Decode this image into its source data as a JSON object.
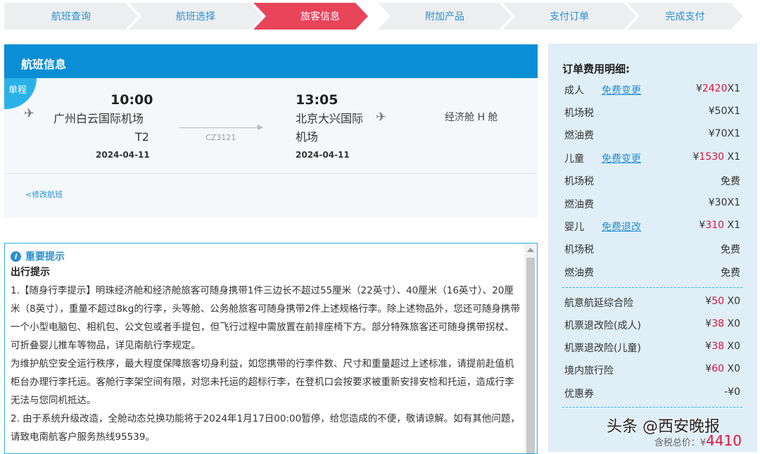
{
  "steps": [
    "航班查询",
    "航班选择",
    "旅客信息",
    "附加产品",
    "支付订单",
    "完成支付"
  ],
  "active_step": 2,
  "flight": {
    "header": "航班信息",
    "tag": "单程",
    "dep_time": "10:00",
    "dep_airport_line1": "广州白云国际机场",
    "dep_airport_line2": "T2",
    "dep_date": "2024-04-11",
    "flight_no": "CZ3121",
    "arr_time": "13:05",
    "arr_airport_line1": "北京大兴国际",
    "arr_airport_line2": "机场",
    "arr_date": "2024-04-11",
    "cabin": "经济舱 H 舱",
    "modify_link": "<修改航班"
  },
  "tips": {
    "title": "重要提示",
    "subtitle": "出行提示",
    "p1": "1.【随身行李提示】明珠经济舱和经济舱旅客可随身携带1件三边长不超过55厘米（22英寸）、40厘米（16英寸）、20厘米（8英寸），重量不超过8kg的行李，头等舱、公务舱旅客可随身携带2件上述规格行李。除上述物品外，您还可随身携带一个小型电脑包、相机包、公文包或者手提包，但飞行过程中需放置在前排座椅下方。部分特殊旅客还可随身携带拐杖、可折叠婴儿推车等物品，详见南航行李规定。",
    "p2": "为维护航空安全运行秩序，最大程度保障旅客切身利益，如您携带的行李件数、尺寸和重量超过上述标准，请提前赴值机柜台办理行李托运。客舱行李架空间有限，对您未托运的超标行李，在登机口会按要求被重新安排安检和托运，造成行李无法与您同机抵达。",
    "p3": "2. 由于系统升级改造，全舱动态兑换功能将于2024年1月17日00:00暂停，给您造成的不便，敬请谅解。如有其他问题，请致电南航客户服务热线95539。"
  },
  "order": {
    "title": "订单费用明细:",
    "rows": [
      {
        "label": "成人",
        "link": "免费变更",
        "cur": "¥",
        "amount": "2420",
        "qty": "X1",
        "amount_red": true
      },
      {
        "label": "机场税",
        "link": "",
        "cur": "",
        "amount": "¥50X1",
        "qty": "",
        "amount_red": false
      },
      {
        "label": "燃油费",
        "link": "",
        "cur": "",
        "amount": "¥70X1",
        "qty": "",
        "amount_red": false
      },
      {
        "label": "儿童",
        "link": "免费变更",
        "cur": "¥",
        "amount": "1530",
        "qty": " X1",
        "amount_red": true
      },
      {
        "label": "机场税",
        "link": "",
        "cur": "",
        "amount": "免费",
        "qty": "",
        "amount_red": false
      },
      {
        "label": "燃油费",
        "link": "",
        "cur": "",
        "amount": "¥30X1",
        "qty": "",
        "amount_red": false
      },
      {
        "label": "婴儿",
        "link": "免费退改",
        "cur": "¥",
        "amount": "310",
        "qty": " X1",
        "amount_red": true
      },
      {
        "label": "机场税",
        "link": "",
        "cur": "",
        "amount": "免费",
        "qty": "",
        "amount_red": false
      },
      {
        "label": "燃油费",
        "link": "",
        "cur": "",
        "amount": "免费",
        "qty": "",
        "amount_red": false
      }
    ],
    "extras": [
      {
        "label": "航意航延综合险",
        "cur": "¥",
        "amount": "50",
        "qty": " X0"
      },
      {
        "label": "机票退改险(成人)",
        "cur": "¥",
        "amount": "38",
        "qty": " X0"
      },
      {
        "label": "机票退改险(儿童)",
        "cur": "¥",
        "amount": "38",
        "qty": " X0"
      },
      {
        "label": "境内旅行险",
        "cur": "¥",
        "amount": "60",
        "qty": " X0"
      }
    ],
    "coupon_label": "优惠券",
    "coupon_value": "-¥0",
    "total_label": "含税总价：¥",
    "total_amount": "4410"
  },
  "watermark": "头条 @西安晚报",
  "colors": {
    "accent": "#0b8ed6",
    "active_step": "#e8445a",
    "step_bg": "#eceef0",
    "price_red": "#e0143c"
  }
}
